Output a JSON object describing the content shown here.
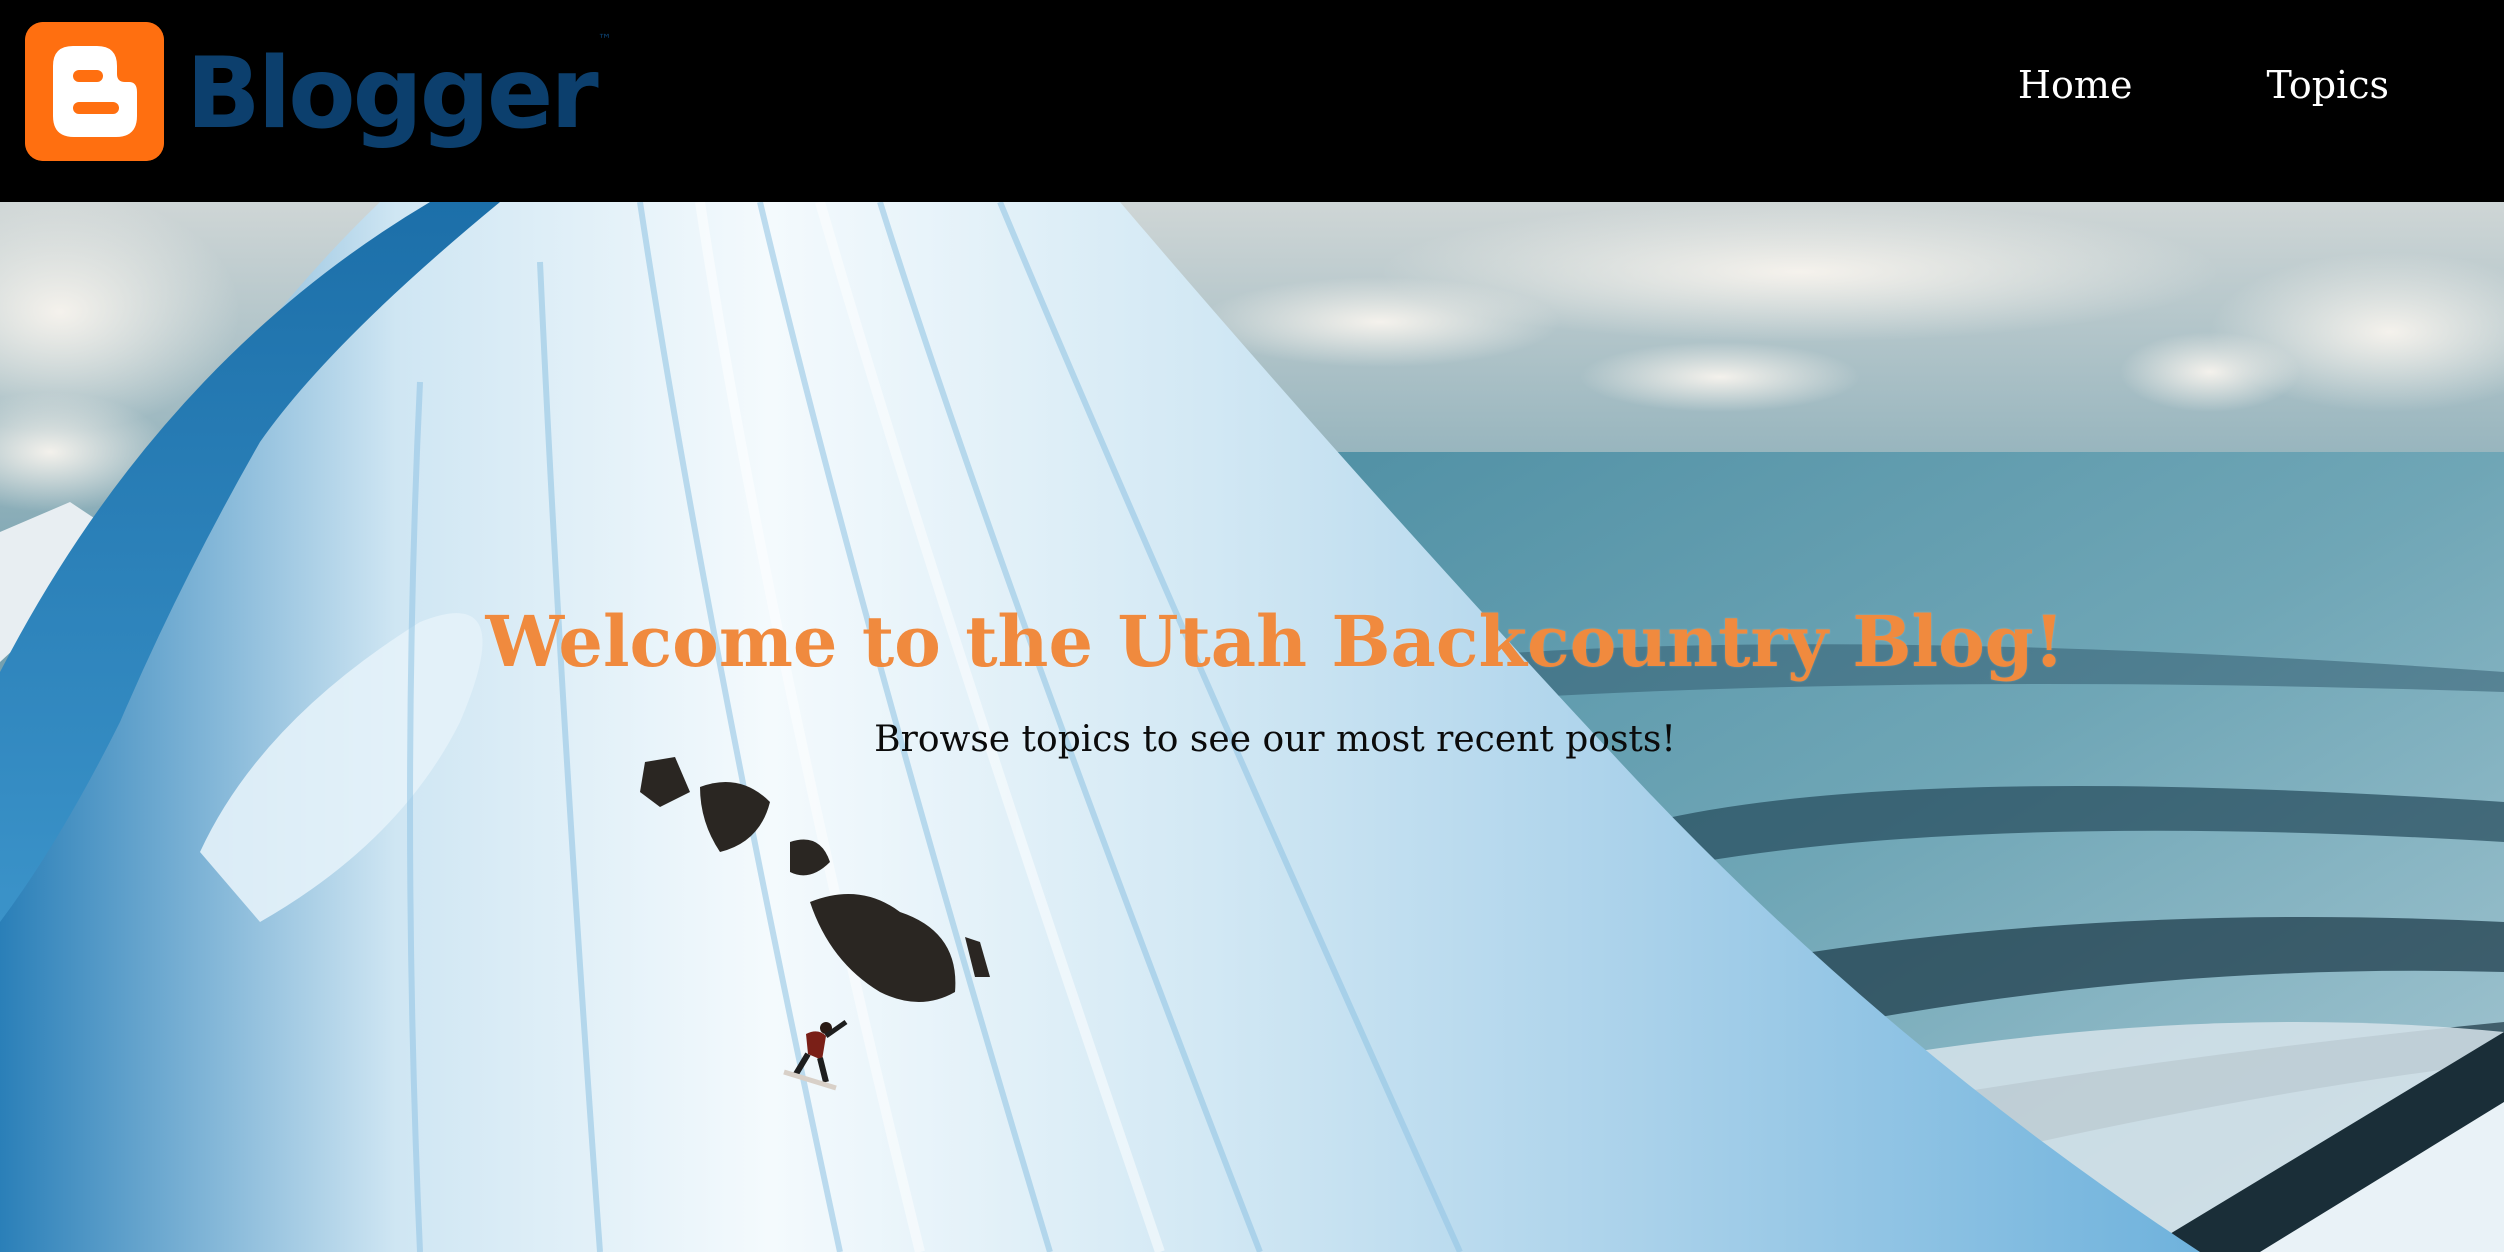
{
  "header": {
    "logo_text": "Blogger",
    "logo_trademark": "™",
    "nav": [
      {
        "label": "Home"
      },
      {
        "label": "Topics"
      }
    ]
  },
  "hero": {
    "title": "Welcome to the Utah Backcountry Blog!",
    "subtitle": "Browse topics to see our most recent posts!",
    "image_description_icon": "snowy-mountain-snowboarder-image"
  },
  "colors": {
    "header_bg": "#000000",
    "logo_orange": "#ff6f10",
    "logo_blue": "#0c3f6d",
    "title_orange": "#f08a3e",
    "nav_text": "#ffffff"
  }
}
